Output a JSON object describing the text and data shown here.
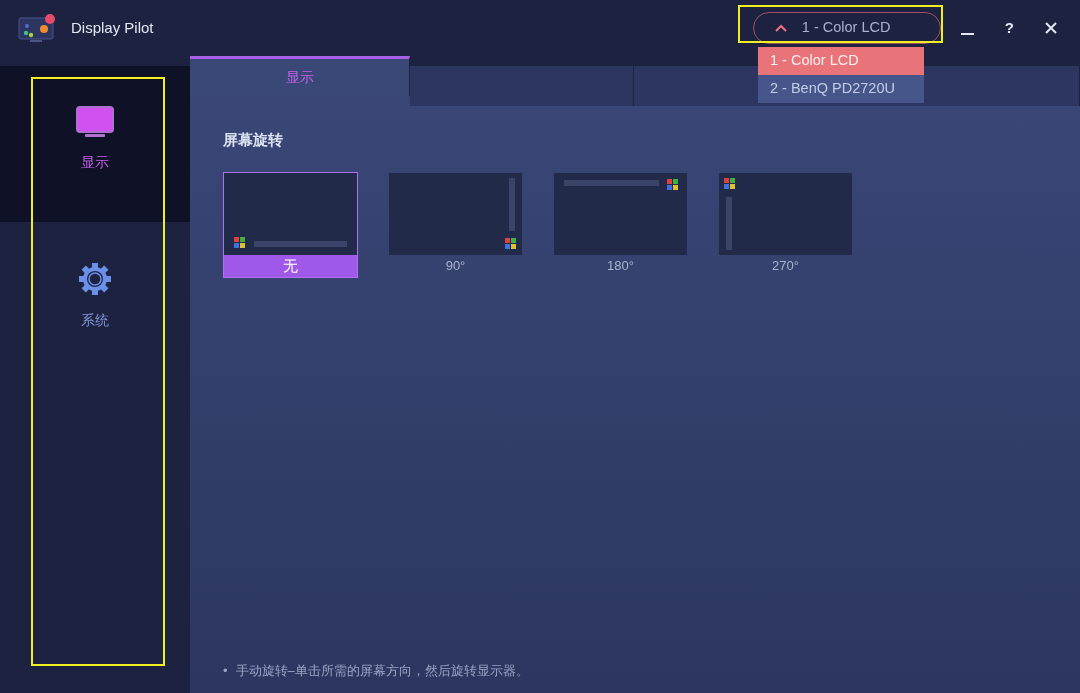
{
  "window": {
    "title": "Display Pilot",
    "help_label": "?"
  },
  "monitor_selector": {
    "value": "1 - Color LCD",
    "expanded": true,
    "options": [
      {
        "label": "1 - Color LCD",
        "selected": true
      },
      {
        "label": "2 - BenQ PD2720U",
        "selected": false
      }
    ]
  },
  "sidebar": {
    "items": [
      {
        "label": "显示",
        "kind": "display",
        "selected": true
      },
      {
        "label": "系统",
        "kind": "system",
        "selected": false
      }
    ]
  },
  "tabs": [
    {
      "label": "显示",
      "selected": true
    },
    {
      "selected": false
    },
    {
      "selected": false
    }
  ],
  "section_title": "屏幕旋转",
  "rotations": [
    {
      "label": "无",
      "kind": "r0",
      "selected": true
    },
    {
      "label": "90°",
      "kind": "r90",
      "selected": false
    },
    {
      "label": "180°",
      "kind": "r180",
      "selected": false
    },
    {
      "label": "270°",
      "kind": "r270",
      "selected": false
    }
  ],
  "note": {
    "bullet": "•",
    "text": "手动旋转–单击所需的屏幕方向，然后旋转显示器。"
  }
}
